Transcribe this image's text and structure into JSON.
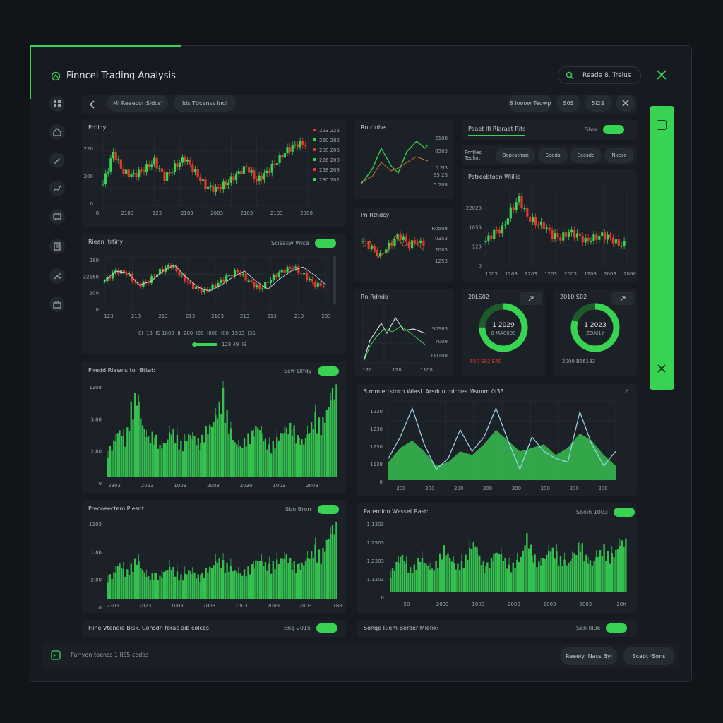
{
  "app": {
    "title": "Finncel Trading Analysis"
  },
  "search": {
    "label": "Reade 8. Trelus"
  },
  "toolbar": {
    "pills": [
      "Ml Reaecor Sidcs'",
      "Ids Tdcenss Indl",
      "8 Iooow Teowp",
      "S0S",
      "5I2S"
    ]
  },
  "panels": {
    "p1": {
      "title": "Prtildy",
      "y_ticks": [
        "220",
        "200",
        "0"
      ],
      "x_ticks": [
        "8",
        "2103",
        "123",
        "2103",
        "2003",
        "2103",
        "2133",
        "2000"
      ],
      "legend": [
        "223 226",
        "260 282",
        "208 206",
        "226 208",
        "258 208",
        "230 202"
      ]
    },
    "p2": {
      "title": "Riean Itrtiny",
      "toggle": "Scisacw Wice",
      "y_ticks": [
        "280",
        "22160",
        "200",
        "0"
      ],
      "x_ticks": [
        "123",
        "213",
        "213",
        "213",
        "2103",
        "213",
        "213",
        "213",
        "283"
      ],
      "legend": "0I ·13 ·IS  1008 ·II  ·280  ·I20  ·I008 ·I00 ·1503 ·I3S",
      "slider": "128 ·I9  ·I9"
    },
    "p3": {
      "title": "Rn clnhe",
      "labels": [
        "2108",
        "0503",
        "0 2I3",
        "S5 2S",
        "5 208"
      ]
    },
    "p4": {
      "title": "Pn Rtndcy",
      "labels": [
        "R0508",
        "0353",
        "2003",
        "1253"
      ]
    },
    "p5": {
      "title": "Rn Rdndo",
      "labels": [
        "S0S8S",
        "7009",
        "D0108"
      ],
      "x_ticks": [
        "120",
        "128",
        "1108"
      ]
    },
    "p6": {
      "title": "Paaet Ifi Rlaraet Rits",
      "toggle": "Sbor"
    },
    "p7": {
      "tabs": [
        "Prntles Teclint",
        "Ocpcstnssi",
        "Soeds",
        "Sccsde",
        "Nkeso"
      ]
    },
    "p8": {
      "title": "Petreebtoon Wiiliis",
      "y_ticks": [
        "22023",
        "1053",
        "123",
        "0"
      ],
      "x_ticks": [
        "1003",
        "1203",
        "2203",
        "1203",
        "2003",
        "1203",
        "2003",
        "2000"
      ]
    },
    "d1": {
      "title": "20LS02",
      "center": "1 2029",
      "sub": "0 MA8009",
      "caption": "F00 E02 E40"
    },
    "d2": {
      "title": "2010 S02",
      "center": "1 2023",
      "sub": "ZOAI1Y",
      "caption": "2000 B56183"
    },
    "p9": {
      "title": "Piredd Rlawns to rBttat:",
      "toggle": "Scw Dlfdy",
      "y_ticks": [
        "1108",
        "3.88",
        "2.80",
        "0"
      ],
      "x_ticks": [
        "2303",
        "2023",
        "1003",
        "2003",
        "2030",
        "1003",
        "2003"
      ]
    },
    "p10": {
      "title": "S mmiertstoch Wlasl. Arsduu roicdes Msonm 0I33",
      "y_ticks": [
        "1230",
        "1230",
        "1230",
        "1138",
        "0"
      ],
      "x_ticks": [
        "200",
        "200",
        "200",
        "200",
        "200",
        "200",
        "200",
        "200"
      ]
    },
    "p11": {
      "title": "Precoeectem Plesnt:",
      "toggle": "Sbn Brorr",
      "y_ticks": [
        "1103",
        "1.88",
        "2.80",
        "0"
      ],
      "x_ticks": [
        "2303",
        "2023",
        "1003",
        "2003",
        "1003",
        "2003",
        "2003",
        "188"
      ]
    },
    "p12": {
      "title": "Pareroion Wesset Rast:",
      "toggle": "Sooin 1003",
      "y_ticks": [
        "1.1303",
        "1.2903",
        "1.2303",
        "1.1303",
        "0"
      ],
      "x_ticks": [
        "50",
        "2003",
        "1003",
        "2003",
        "2003",
        "2003",
        "20h"
      ]
    },
    "s1": {
      "title": "Fiine Vtendio Bisk. Consdn forac aib colces",
      "toggle": "Eng 2015"
    },
    "s2": {
      "title": "Sonqe Riem Beroer Mlonk:",
      "toggle": "Sen Ill0e"
    }
  },
  "footer": {
    "text": "Parrvon toenss 1 IIS5 codas",
    "btn1": "Reeely: Nacs Byi",
    "btn2": "Scabt ·Sons"
  },
  "colors": {
    "accent": "#39d353",
    "down": "#e5382b",
    "bg": "#171b21",
    "panel": "#1c2128"
  },
  "chart_data": [
    {
      "type": "candlestick",
      "title": "Prtildy",
      "series": [
        {
          "name": "candles",
          "values": [
            40,
            95,
            60,
            55,
            65,
            80,
            50,
            70,
            85,
            60,
            35,
            30,
            40,
            55,
            70,
            45,
            60,
            80,
            100,
            110
          ]
        }
      ]
    },
    {
      "type": "line",
      "title": "Riean Itrtiny",
      "series": [
        {
          "name": "price",
          "values": [
            70,
            95,
            90,
            60,
            70,
            95,
            110,
            80,
            55,
            45,
            60,
            80,
            95,
            70,
            50,
            75,
            95,
            105,
            85,
            60
          ]
        }
      ]
    },
    {
      "type": "bar",
      "title": "Piredd Rlawns to rBttat:",
      "series": [
        {
          "name": "volume",
          "values": [
            30,
            40,
            55,
            40,
            80,
            95,
            60,
            45,
            50,
            35,
            40,
            55,
            45,
            35,
            50,
            45,
            40,
            55,
            60,
            75,
            95,
            60,
            40,
            35,
            45,
            50,
            60,
            45,
            35,
            40,
            50,
            55,
            60,
            45,
            40,
            55,
            70,
            60,
            75,
            100
          ]
        }
      ]
    },
    {
      "type": "area",
      "title": "S mmiertstoch Wlasl. Arsduu roicdes Msonm 0I33",
      "series": [
        {
          "name": "area",
          "values": [
            25,
            45,
            55,
            40,
            20,
            25,
            40,
            35,
            50,
            70,
            55,
            40,
            45,
            50,
            35,
            45,
            65,
            55,
            35,
            20
          ]
        },
        {
          "name": "line",
          "values": [
            30,
            60,
            100,
            50,
            15,
            30,
            70,
            40,
            60,
            100,
            55,
            15,
            60,
            40,
            30,
            25,
            95,
            50,
            20,
            40
          ]
        }
      ]
    },
    {
      "type": "bar",
      "title": "Precoeectem Plesnt:",
      "series": [
        {
          "name": "volume",
          "values": [
            30,
            35,
            50,
            35,
            45,
            55,
            40,
            30,
            35,
            30,
            40,
            45,
            35,
            30,
            40,
            35,
            30,
            40,
            45,
            55,
            50,
            45,
            40,
            35,
            40,
            45,
            55,
            50,
            45,
            50,
            55,
            60,
            50,
            45,
            50,
            60,
            70,
            60,
            80,
            100
          ]
        }
      ]
    },
    {
      "type": "bar",
      "title": "Pareroion Wesset Rast:",
      "series": [
        {
          "name": "volume",
          "values": [
            30,
            45,
            60,
            35,
            40,
            55,
            45,
            35,
            50,
            70,
            55,
            40,
            45,
            60,
            80,
            55,
            40,
            50,
            65,
            55,
            40,
            45,
            55,
            90,
            60,
            45,
            55,
            70,
            60,
            50,
            45,
            60,
            80,
            55,
            45,
            60,
            70,
            55,
            65,
            80
          ]
        }
      ]
    },
    {
      "type": "pie",
      "title": "20LS02",
      "values": [
        75,
        25
      ]
    },
    {
      "type": "pie",
      "title": "2010 S02",
      "values": [
        80,
        20
      ]
    }
  ]
}
